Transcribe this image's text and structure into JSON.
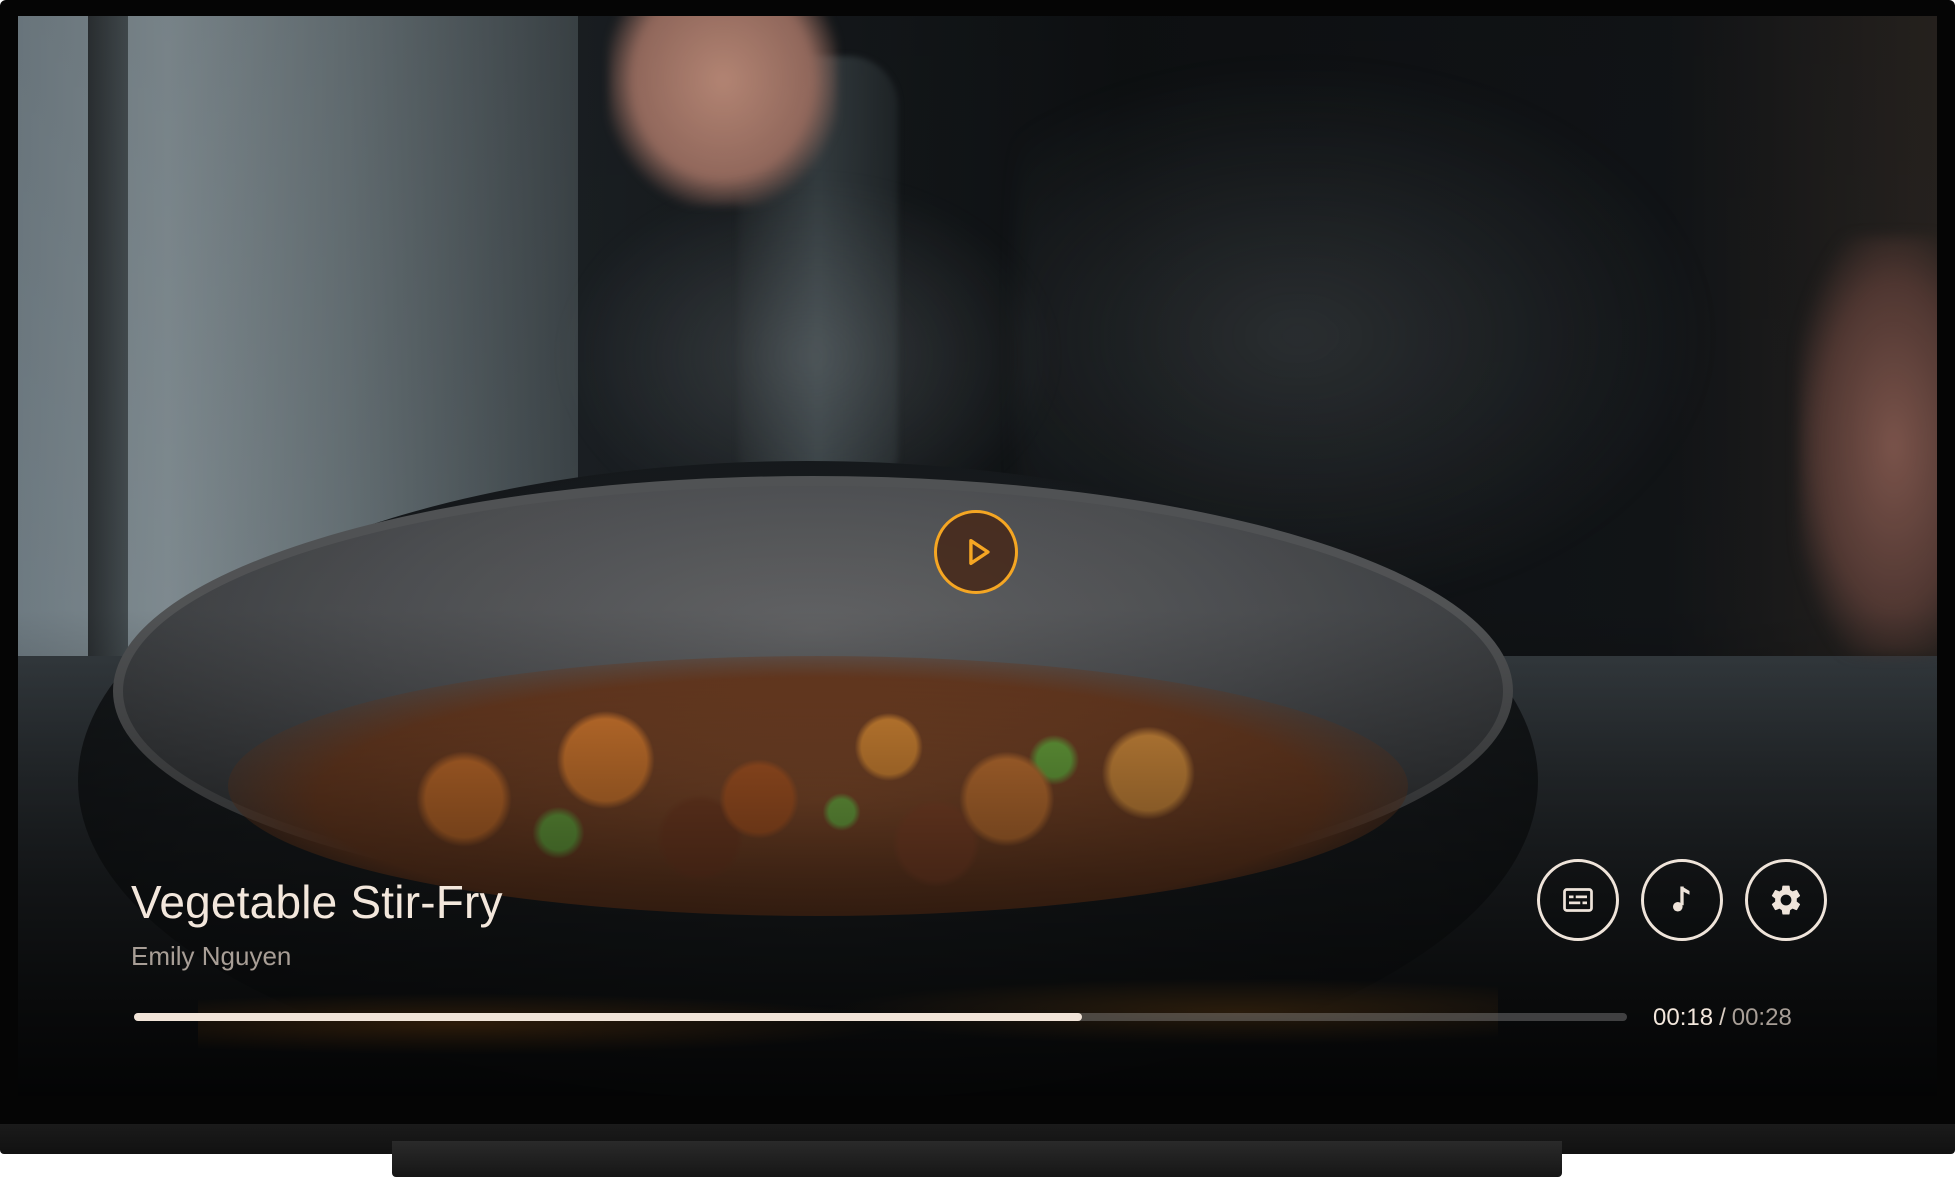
{
  "video": {
    "title": "Vegetable Stir-Fry",
    "author": "Emily Nguyen",
    "current_time": "00:18",
    "time_separator": "/",
    "duration": "00:28",
    "progress_fraction": 0.635
  },
  "controls": {
    "play_icon": "play-icon",
    "captions_icon": "captions-icon",
    "audio_icon": "music-note-icon",
    "settings_icon": "gear-icon"
  },
  "colors": {
    "accent": "#f5a623",
    "text_primary": "#f3e7dc",
    "text_secondary": "#a89e96",
    "progress_fill": "#f1e4d8"
  }
}
